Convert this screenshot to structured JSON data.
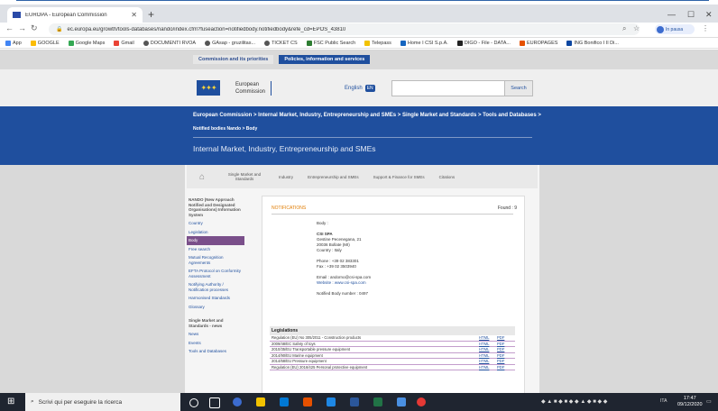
{
  "browser": {
    "tab_title": "EUROPA - European Commission",
    "url": "ec.europa.eu/growth/tools-databases/nando/index.cfm?fuseaction=notifiedbody.notifiedbody&refe_cd=EPOS_43810",
    "profile_label": "In pausa",
    "bookmarks": [
      "App",
      "GOOGLE",
      "Google Maps",
      "Gmail",
      "DOCUMENTI RVOA",
      "GAsap - gruzilitas...",
      "TICKET CS",
      "FSC Public Search",
      "Telepass",
      "Home I CSI S.p.A.",
      "DIGO - File - DATA...",
      "EUROPAGES",
      "ING Bonifico I Il Di..."
    ]
  },
  "page": {
    "top_tabs": [
      "Commission and its priorities",
      "Policies, information and services"
    ],
    "logo_text_1": "European",
    "logo_text_2": "Commission",
    "language": "English",
    "language_code": "EN",
    "search_button": "Search",
    "breadcrumb": "European Commission > Internal Market, Industry, Entrepreneurship and SMEs > Single Market and Standards > Tools and Databases >",
    "breadcrumb2": "Notified bodies Nando > Body",
    "site_title": "Internal Market, Industry, Entrepreneurship and SMEs",
    "nav_items": [
      "Single Market and Standards",
      "Industry",
      "Entrepreneurship and SMEs",
      "Support & Finance for SMEs",
      "Citations"
    ],
    "sidebar": {
      "heading": "NANDO (New Approach Notified and Designated Organisations) Information System",
      "items": [
        "Country",
        "Legislation",
        "Body",
        "Free search",
        "Mutual Recognition Agreements",
        "EFTA Protocol on Conformity Assessment",
        "Notifying Authority / Notification processes",
        "Harmonised Standards",
        "Glossary"
      ],
      "selected_index": 2,
      "section2": "Single Market and Standards - news",
      "items2": [
        "News",
        "Events",
        "Tools and Databases"
      ]
    },
    "panel": {
      "notification_label": "NOTIFICATIONS",
      "found": "Found : 9",
      "body_label": "Body :",
      "company": "CSI SPA",
      "address1": "Gestine Pecenegana, 21",
      "address2": "20036 Bollate (MI)",
      "country": "Country : Italy",
      "phone": "Phone : +39 02 383301",
      "fax": "Fax : +39 02 3503940",
      "email": "Email : andorno@csi-spa.com",
      "website": "Website : www.csi-spa.com",
      "body_number": "Notified Body number : 0497",
      "legislation_heading": "Legislations",
      "legislations": [
        "Regulation (EU) No 305/2011 - Construction products",
        "2009/48/EC Safety of toys",
        "2010/35/EU Transportable pressure equipment",
        "2014/90/EU Marine equipment",
        "2014/68/EU Pressure equipment",
        "Regulation (EU) 2016/425 Personal protective equipment"
      ],
      "link_html": "HTML",
      "link_pdf": "PDF"
    }
  },
  "taskbar": {
    "search_placeholder": "Scrivi qui per eseguire la ricerca",
    "time": "17:47",
    "date": "09/12/2020",
    "lang": "ITA"
  },
  "colors": {
    "ec_blue": "#1f4f9e",
    "sidebar_selected": "#7a4f8a",
    "notification_orange": "#e07b00"
  }
}
